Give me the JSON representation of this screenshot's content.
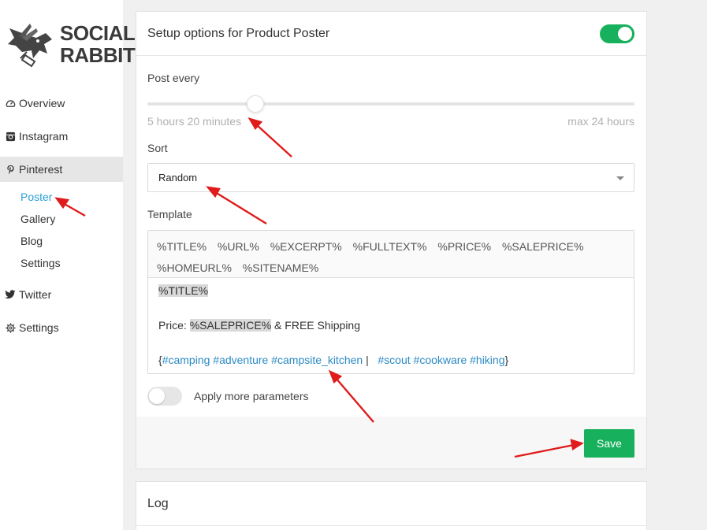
{
  "brand": {
    "line1": "SOCIAL",
    "line2": "RABBIT"
  },
  "sidebar": {
    "items": [
      {
        "label": "Overview",
        "icon": "dashboard-icon"
      },
      {
        "label": "Instagram",
        "icon": "instagram-icon"
      },
      {
        "label": "Pinterest",
        "icon": "pinterest-icon"
      },
      {
        "label": "Twitter",
        "icon": "twitter-icon"
      },
      {
        "label": "Settings",
        "icon": "gear-icon"
      }
    ],
    "pinterest_sub": [
      "Poster",
      "Gallery",
      "Blog",
      "Settings"
    ]
  },
  "card": {
    "title": "Setup options for Product Poster",
    "enabled": true,
    "post_every_label": "Post every",
    "post_every_value": "5 hours 20 minutes",
    "post_every_max": "max 24 hours",
    "slider_fraction": 0.222,
    "sort_label": "Sort",
    "sort_value": "Random",
    "template_label": "Template",
    "tags": [
      "%TITLE%",
      "%URL%",
      "%EXCERPT%",
      "%FULLTEXT%",
      "%PRICE%",
      "%SALEPRICE%",
      "%HOMEURL%",
      "%SITENAME%"
    ],
    "template": {
      "line1": "%TITLE%",
      "line2_prefix": "Price: ",
      "line2_tag": "%SALEPRICE%",
      "line2_suffix": " & FREE Shipping",
      "line3_open": "{",
      "line3_links_a": "#camping #adventure #campsite_kitchen",
      "line3_sep": " |   ",
      "line3_links_b": "#scout #cookware #hiking",
      "line3_close": "}"
    },
    "more_params_label": "Apply more parameters",
    "save_label": "Save"
  },
  "log": {
    "title": "Log"
  },
  "colors": {
    "accent_green": "#17b05c",
    "link_blue": "#2a9fd6",
    "arrow_red": "#e01b1b"
  }
}
